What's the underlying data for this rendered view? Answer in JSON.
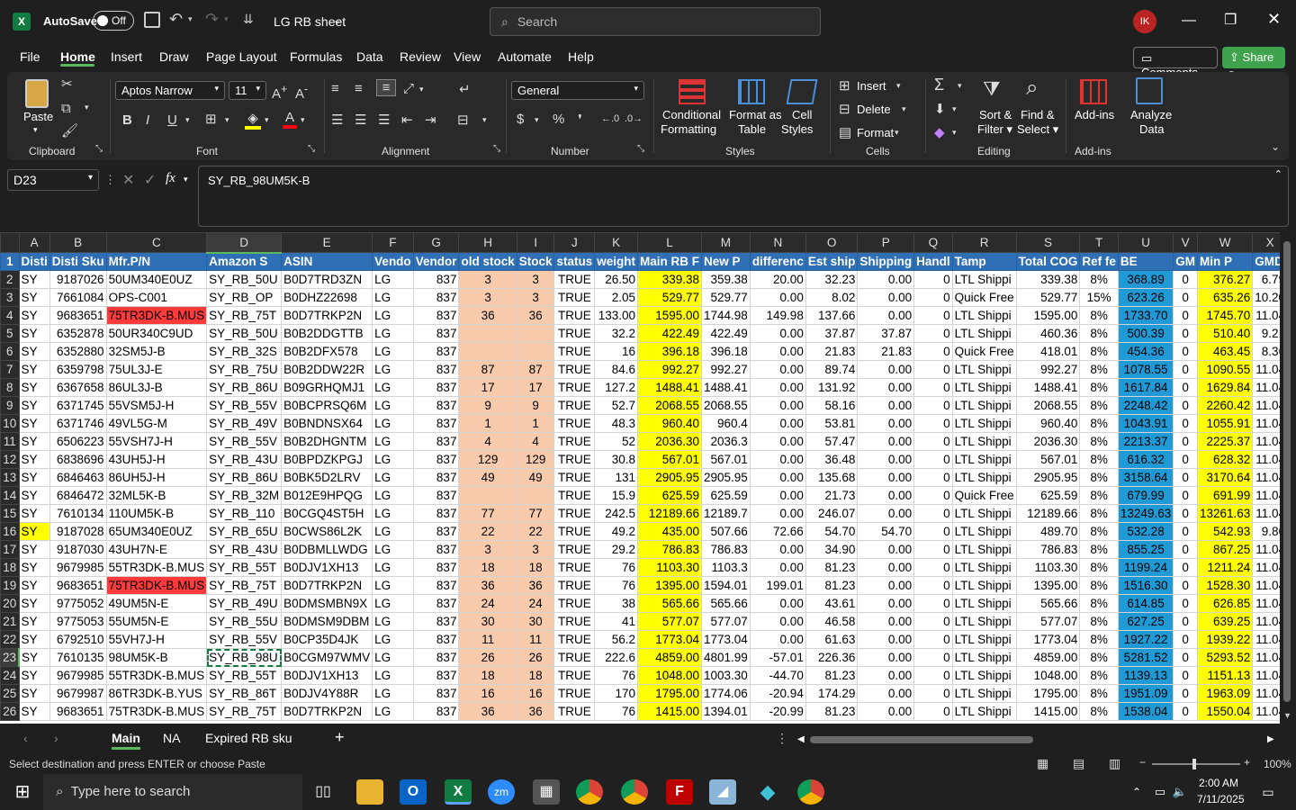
{
  "app": {
    "autosave_label": "AutoSave",
    "autosave_state": "Off",
    "file_title": "LG RB sheet",
    "search_placeholder": "Search",
    "avatar": "IK"
  },
  "menu": [
    "File",
    "Home",
    "Insert",
    "Draw",
    "Page Layout",
    "Formulas",
    "Data",
    "Review",
    "View",
    "Automate",
    "Help"
  ],
  "menu_right": {
    "comments": "Comments",
    "share": "Share"
  },
  "ribbon": {
    "clipboard": {
      "label": "Clipboard",
      "paste": "Paste"
    },
    "font": {
      "label": "Font",
      "family": "Aptos Narrow",
      "size": "11"
    },
    "alignment": {
      "label": "Alignment"
    },
    "number": {
      "label": "Number",
      "format": "General"
    },
    "styles": {
      "label": "Styles",
      "conditional": "Conditional",
      "formatting": "Formatting",
      "format_as": "Format as",
      "table": "Table",
      "cell": "Cell",
      "styles": "Styles"
    },
    "cells": {
      "label": "Cells",
      "insert": "Insert",
      "delete": "Delete",
      "format": "Format"
    },
    "editing": {
      "label": "Editing",
      "sort": "Sort &",
      "filter": "Filter",
      "find": "Find &",
      "select": "Select"
    },
    "addins": {
      "label": "Add-ins",
      "addins": "Add-ins",
      "analyze": "Analyze",
      "data": "Data"
    }
  },
  "formula_bar": {
    "name_box": "D23",
    "fx": "fx",
    "content": "SY_RB_98UM5K-B"
  },
  "columns": [
    "A",
    "B",
    "C",
    "D",
    "E",
    "F",
    "G",
    "H",
    "I",
    "J",
    "K",
    "L",
    "M",
    "N",
    "O",
    "P",
    "Q",
    "R",
    "S",
    "T",
    "U",
    "V",
    "W",
    "X"
  ],
  "header_row": [
    "Disti",
    "Disti Sku",
    "Mfr.P/N",
    "Amazon S",
    "ASIN",
    "Vendo",
    "Vendor",
    "old stock",
    "Stock",
    "status",
    "weight",
    "Main RB F",
    "New P",
    "differenc",
    "Est ship",
    "Shipping",
    "Handl",
    "Tamp",
    "Total COG",
    "Ref fe",
    "BE",
    "GM",
    "Min P",
    "GMD"
  ],
  "rows": [
    [
      "SY",
      "9187026",
      "50UM340E0UZ",
      "SY_RB_50U",
      "B0D7TRD3ZN",
      "LG",
      "837",
      "3",
      "3",
      "TRUE",
      "26.50",
      "339.38",
      "359.38",
      "20.00",
      "32.23",
      "0.00",
      "0",
      "LTL Shippi",
      "339.38",
      "8%",
      "368.89",
      "0",
      "376.27",
      "6.79"
    ],
    [
      "SY",
      "7661084",
      "OPS-C001",
      "SY_RB_OP",
      "B0DHZ22698",
      "LG",
      "837",
      "3",
      "3",
      "TRUE",
      "2.05",
      "529.77",
      "529.77",
      "0.00",
      "8.02",
      "0.00",
      "0",
      "Quick Free",
      "529.77",
      "15%",
      "623.26",
      "0",
      "635.26",
      "10.20"
    ],
    [
      "SY",
      "9683651",
      "75TR3DK-B.MUS",
      "SY_RB_75T",
      "B0D7TRKP2N",
      "LG",
      "837",
      "36",
      "36",
      "TRUE",
      "133.00",
      "1595.00",
      "1744.98",
      "149.98",
      "137.66",
      "0.00",
      "0",
      "LTL Shippi",
      "1595.00",
      "8%",
      "1733.70",
      "0",
      "1745.70",
      "11.04"
    ],
    [
      "SY",
      "6352878",
      "50UR340C9UD",
      "SY_RB_50U",
      "B0B2DDGTTB",
      "LG",
      "837",
      "",
      "",
      "TRUE",
      "32.2",
      "422.49",
      "422.49",
      "0.00",
      "37.87",
      "37.87",
      "0",
      "LTL Shippi",
      "460.36",
      "8%",
      "500.39",
      "0",
      "510.40",
      "9.21"
    ],
    [
      "SY",
      "6352880",
      "32SM5J-B",
      "SY_RB_32S",
      "B0B2DFX578",
      "LG",
      "837",
      "",
      "",
      "TRUE",
      "16",
      "396.18",
      "396.18",
      "0.00",
      "21.83",
      "21.83",
      "0",
      "Quick Free",
      "418.01",
      "8%",
      "454.36",
      "0",
      "463.45",
      "8.36"
    ],
    [
      "SY",
      "6359798",
      "75UL3J-E",
      "SY_RB_75U",
      "B0B2DDW22R",
      "LG",
      "837",
      "87",
      "87",
      "TRUE",
      "84.6",
      "992.27",
      "992.27",
      "0.00",
      "89.74",
      "0.00",
      "0",
      "LTL Shippi",
      "992.27",
      "8%",
      "1078.55",
      "0",
      "1090.55",
      "11.04"
    ],
    [
      "SY",
      "6367658",
      "86UL3J-B",
      "SY_RB_86U",
      "B09GRHQMJ1",
      "LG",
      "837",
      "17",
      "17",
      "TRUE",
      "127.2",
      "1488.41",
      "1488.41",
      "0.00",
      "131.92",
      "0.00",
      "0",
      "LTL Shippi",
      "1488.41",
      "8%",
      "1617.84",
      "0",
      "1629.84",
      "11.04"
    ],
    [
      "SY",
      "6371745",
      "55VSM5J-H",
      "SY_RB_55V",
      "B0BCPRSQ6M",
      "LG",
      "837",
      "9",
      "9",
      "TRUE",
      "52.7",
      "2068.55",
      "2068.55",
      "0.00",
      "58.16",
      "0.00",
      "0",
      "LTL Shippi",
      "2068.55",
      "8%",
      "2248.42",
      "0",
      "2260.42",
      "11.04"
    ],
    [
      "SY",
      "6371746",
      "49VL5G-M",
      "SY_RB_49V",
      "B0BNDNSX64",
      "LG",
      "837",
      "1",
      "1",
      "TRUE",
      "48.3",
      "960.40",
      "960.4",
      "0.00",
      "53.81",
      "0.00",
      "0",
      "LTL Shippi",
      "960.40",
      "8%",
      "1043.91",
      "0",
      "1055.91",
      "11.04"
    ],
    [
      "SY",
      "6506223",
      "55VSH7J-H",
      "SY_RB_55V",
      "B0B2DHGNTM",
      "LG",
      "837",
      "4",
      "4",
      "TRUE",
      "52",
      "2036.30",
      "2036.3",
      "0.00",
      "57.47",
      "0.00",
      "0",
      "LTL Shippi",
      "2036.30",
      "8%",
      "2213.37",
      "0",
      "2225.37",
      "11.04"
    ],
    [
      "SY",
      "6838696",
      "43UH5J-H",
      "SY_RB_43U",
      "B0BPDZKPGJ",
      "LG",
      "837",
      "129",
      "129",
      "TRUE",
      "30.8",
      "567.01",
      "567.01",
      "0.00",
      "36.48",
      "0.00",
      "0",
      "LTL Shippi",
      "567.01",
      "8%",
      "616.32",
      "0",
      "628.32",
      "11.04"
    ],
    [
      "SY",
      "6846463",
      "86UH5J-H",
      "SY_RB_86U",
      "B0BK5D2LRV",
      "LG",
      "837",
      "49",
      "49",
      "TRUE",
      "131",
      "2905.95",
      "2905.95",
      "0.00",
      "135.68",
      "0.00",
      "0",
      "LTL Shippi",
      "2905.95",
      "8%",
      "3158.64",
      "0",
      "3170.64",
      "11.04"
    ],
    [
      "SY",
      "6846472",
      "32ML5K-B",
      "SY_RB_32M",
      "B012E9HPQG",
      "LG",
      "837",
      "",
      "",
      "TRUE",
      "15.9",
      "625.59",
      "625.59",
      "0.00",
      "21.73",
      "0.00",
      "0",
      "Quick Free",
      "625.59",
      "8%",
      "679.99",
      "0",
      "691.99",
      "11.04"
    ],
    [
      "SY",
      "7610134",
      "110UM5K-B",
      "SY_RB_110",
      "B0CGQ4ST5H",
      "LG",
      "837",
      "77",
      "77",
      "TRUE",
      "242.5",
      "12189.66",
      "12189.7",
      "0.00",
      "246.07",
      "0.00",
      "0",
      "LTL Shippi",
      "12189.66",
      "8%",
      "13249.63",
      "0",
      "13261.63",
      "11.04"
    ],
    [
      "SY",
      "9187028",
      "65UM340E0UZ",
      "SY_RB_65U",
      "B0CWS86L2K",
      "LG",
      "837",
      "22",
      "22",
      "TRUE",
      "49.2",
      "435.00",
      "507.66",
      "72.66",
      "54.70",
      "54.70",
      "0",
      "LTL Shippi",
      "489.70",
      "8%",
      "532.28",
      "0",
      "542.93",
      "9.80"
    ],
    [
      "SY",
      "9187030",
      "43UH7N-E",
      "SY_RB_43U",
      "B0DBMLLWDG",
      "LG",
      "837",
      "3",
      "3",
      "TRUE",
      "29.2",
      "786.83",
      "786.83",
      "0.00",
      "34.90",
      "0.00",
      "0",
      "LTL Shippi",
      "786.83",
      "8%",
      "855.25",
      "0",
      "867.25",
      "11.04"
    ],
    [
      "SY",
      "9679985",
      "55TR3DK-B.MUS",
      "SY_RB_55T",
      "B0DJV1XH13",
      "LG",
      "837",
      "18",
      "18",
      "TRUE",
      "76",
      "1103.30",
      "1103.3",
      "0.00",
      "81.23",
      "0.00",
      "0",
      "LTL Shippi",
      "1103.30",
      "8%",
      "1199.24",
      "0",
      "1211.24",
      "11.04"
    ],
    [
      "SY",
      "9683651",
      "75TR3DK-B.MUS",
      "SY_RB_75T",
      "B0D7TRKP2N",
      "LG",
      "837",
      "36",
      "36",
      "TRUE",
      "76",
      "1395.00",
      "1594.01",
      "199.01",
      "81.23",
      "0.00",
      "0",
      "LTL Shippi",
      "1395.00",
      "8%",
      "1516.30",
      "0",
      "1528.30",
      "11.04"
    ],
    [
      "SY",
      "9775052",
      "49UM5N-E",
      "SY_RB_49U",
      "B0DMSMBN9X",
      "LG",
      "837",
      "24",
      "24",
      "TRUE",
      "38",
      "565.66",
      "565.66",
      "0.00",
      "43.61",
      "0.00",
      "0",
      "LTL Shippi",
      "565.66",
      "8%",
      "614.85",
      "0",
      "626.85",
      "11.04"
    ],
    [
      "SY",
      "9775053",
      "55UM5N-E",
      "SY_RB_55U",
      "B0DMSM9DBM",
      "LG",
      "837",
      "30",
      "30",
      "TRUE",
      "41",
      "577.07",
      "577.07",
      "0.00",
      "46.58",
      "0.00",
      "0",
      "LTL Shippi",
      "577.07",
      "8%",
      "627.25",
      "0",
      "639.25",
      "11.04"
    ],
    [
      "SY",
      "6792510",
      "55VH7J-H",
      "SY_RB_55V",
      "B0CP35D4JK",
      "LG",
      "837",
      "11",
      "11",
      "TRUE",
      "56.2",
      "1773.04",
      "1773.04",
      "0.00",
      "61.63",
      "0.00",
      "0",
      "LTL Shippi",
      "1773.04",
      "8%",
      "1927.22",
      "0",
      "1939.22",
      "11.04"
    ],
    [
      "SY",
      "7610135",
      "98UM5K-B",
      "SY_RB_98U",
      "B0CGM97WMV",
      "LG",
      "837",
      "26",
      "26",
      "TRUE",
      "222.6",
      "4859.00",
      "4801.99",
      "-57.01",
      "226.36",
      "0.00",
      "0",
      "LTL Shippi",
      "4859.00",
      "8%",
      "5281.52",
      "0",
      "5293.52",
      "11.04"
    ],
    [
      "SY",
      "9679985",
      "55TR3DK-B.MUS",
      "SY_RB_55T",
      "B0DJV1XH13",
      "LG",
      "837",
      "18",
      "18",
      "TRUE",
      "76",
      "1048.00",
      "1003.30",
      "-44.70",
      "81.23",
      "0.00",
      "0",
      "LTL Shippi",
      "1048.00",
      "8%",
      "1139.13",
      "0",
      "1151.13",
      "11.04"
    ],
    [
      "SY",
      "9679987",
      "86TR3DK-B.YUS",
      "SY_RB_86T",
      "B0DJV4Y88R",
      "LG",
      "837",
      "16",
      "16",
      "TRUE",
      "170",
      "1795.00",
      "1774.06",
      "-20.94",
      "174.29",
      "0.00",
      "0",
      "LTL Shippi",
      "1795.00",
      "8%",
      "1951.09",
      "0",
      "1963.09",
      "11.04"
    ],
    [
      "SY",
      "9683651",
      "75TR3DK-B.MUS",
      "SY_RB_75T",
      "B0D7TRKP2N",
      "LG",
      "837",
      "36",
      "36",
      "TRUE",
      "76",
      "1415.00",
      "1394.01",
      "-20.99",
      "81.23",
      "0.00",
      "0",
      "LTL Shippi",
      "1415.00",
      "8%",
      "1538.04",
      "0",
      "1550.04",
      "11.04"
    ]
  ],
  "sheet_tabs": [
    "Main",
    "NA",
    "Expired RB sku"
  ],
  "status": {
    "message": "Select destination and press ENTER or choose Paste",
    "zoom": "100%"
  },
  "taskbar": {
    "search": "Type here to search",
    "time": "2:00 AM",
    "date": "7/11/2025"
  }
}
